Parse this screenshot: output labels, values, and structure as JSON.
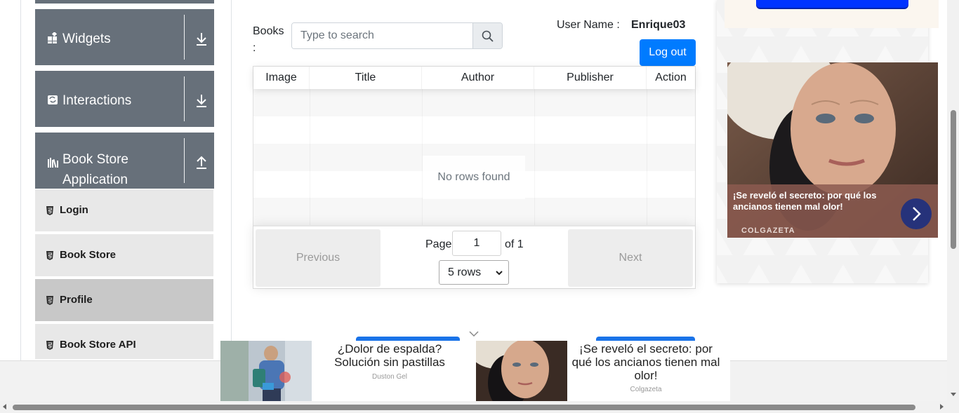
{
  "sidebar": {
    "groups": [
      {
        "label": "Widgets",
        "icon": "widgets-icon",
        "arrow": "download-arrow-icon"
      },
      {
        "label": "Interactions",
        "icon": "interactions-icon",
        "arrow": "download-arrow-icon"
      },
      {
        "label": "Book Store Application",
        "label_line1": "Book Store",
        "label_line2": "Application",
        "icon": "books-icon",
        "arrow": "upload-arrow-icon"
      }
    ],
    "items": [
      {
        "label": "Login",
        "active": false
      },
      {
        "label": "Book Store",
        "active": false
      },
      {
        "label": "Profile",
        "active": true
      },
      {
        "label": "Book Store API",
        "active": false
      }
    ]
  },
  "main": {
    "books_label": "Books :",
    "search": {
      "placeholder": "Type to search",
      "value": ""
    },
    "user": {
      "label": "User Name :",
      "value": "Enrique03"
    },
    "logout_label": "Log out",
    "table": {
      "columns": [
        "Image",
        "Title",
        "Author",
        "Publisher",
        "Action"
      ],
      "rows": [],
      "empty_text": "No rows found"
    },
    "pagination": {
      "previous_label": "Previous",
      "next_label": "Next",
      "page_label": "Page",
      "page_value": "1",
      "of_label": "of 1",
      "rows_option": "5 rows"
    }
  },
  "ads": {
    "right": {
      "headline": "¡Se reveló el secreto: por qué los ancianos tienen mal olor!",
      "source": "COLGAZETA"
    },
    "bottom": [
      {
        "title": "¿Dolor de espalda? Solución sin pastillas",
        "source": "Duston Gel"
      },
      {
        "title": "¡Se reveló el secreto: por qué los ancianos tienen mal olor!",
        "source": "Colgazeta"
      }
    ]
  },
  "colors": {
    "sidebar_group": "#67707a",
    "menu_item": "#e8e8e8",
    "menu_item_active": "#c8c8c8",
    "primary": "#007bff"
  }
}
